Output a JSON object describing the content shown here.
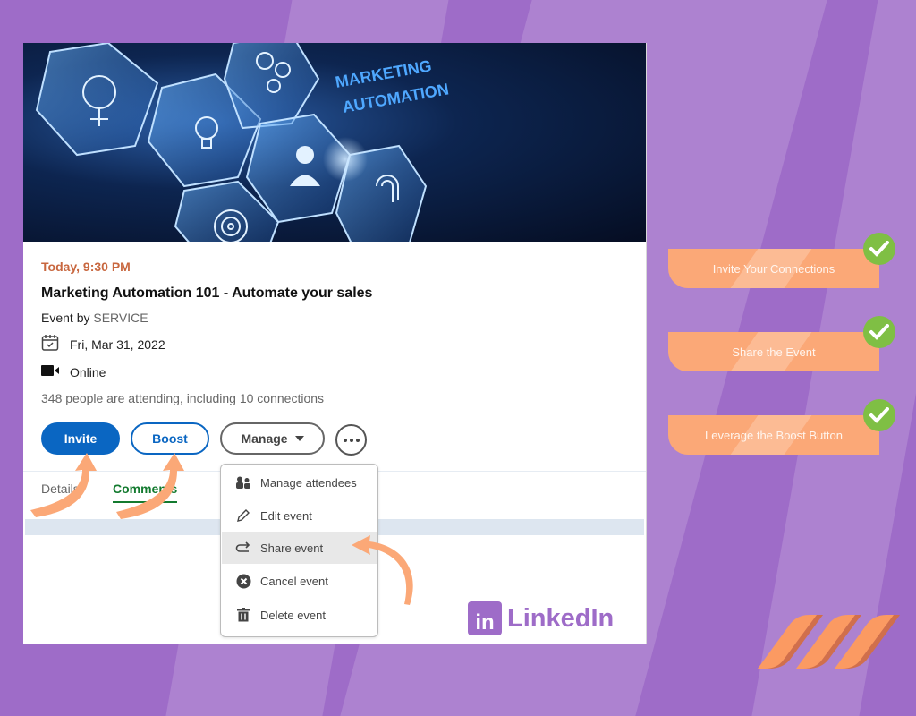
{
  "banner": {
    "headline_line1": "MARKETING",
    "headline_line2": "AUTOMATION",
    "image_description": "hexagon icons: brain, lightbulb, gears, person, target, fingerprint"
  },
  "event": {
    "time": "Today, 9:30 PM",
    "title": "Marketing Automation 101 - Automate your sales",
    "by_prefix": "Event by",
    "organizer": "SERVICE",
    "date": "Fri, Mar 31, 2022",
    "location": "Online",
    "attendance": "348 people are attending, including 10 connections"
  },
  "actions": {
    "invite": "Invite",
    "boost": "Boost",
    "manage": "Manage",
    "more_icon": "ellipsis-icon"
  },
  "tabs": [
    {
      "label": "Details",
      "active": false
    },
    {
      "label": "Comments",
      "active": true
    }
  ],
  "manage_menu": [
    {
      "label": "Manage attendees",
      "icon": "people-icon",
      "highlighted": false
    },
    {
      "label": "Edit event",
      "icon": "pencil-icon",
      "highlighted": false
    },
    {
      "label": "Share event",
      "icon": "share-arrow-icon",
      "highlighted": true
    },
    {
      "label": "Cancel event",
      "icon": "cancel-circle-icon",
      "highlighted": false
    },
    {
      "label": "Delete event",
      "icon": "trash-icon",
      "highlighted": false
    }
  ],
  "brand": {
    "logo_mark": "in",
    "name": "LinkedIn"
  },
  "checklist": [
    {
      "label": "Invite Your Connections",
      "done": true
    },
    {
      "label": "Share the Event",
      "done": true
    },
    {
      "label": "Leverage the Boost Button",
      "done": true
    }
  ],
  "colors": {
    "bg_dark": "#9E6CC8",
    "bg_light": "#AD82D0",
    "linkedin_blue": "#0A66C2",
    "time_orange": "#C8673F",
    "tab_green": "#137A2F",
    "pill_orange": "#FBA877",
    "check_green": "#7FBF44",
    "arrow_orange": "#FBA877"
  }
}
